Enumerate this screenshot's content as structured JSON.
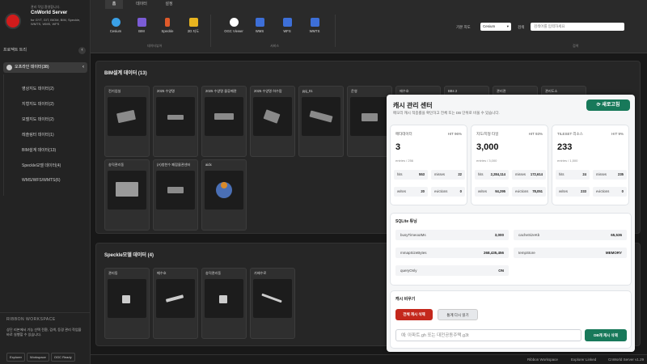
{
  "brand": {
    "subtitle": "관리 작업 환영합니다.",
    "name": "CnWorld Server",
    "desc": "for GYT, GIT, BIOM, BIM, Speckle, WMTS, WMS, WFS"
  },
  "sidebar": {
    "project_tree_label": "프로젝트 트리",
    "root": {
      "label": "오프라인 데이터(38)"
    },
    "items": [
      {
        "label": "영상지도 데이터(2)"
      },
      {
        "label": "지형지도 데이터(2)"
      },
      {
        "label": "모델지도 데이터(2)"
      },
      {
        "label": "레솔링터 데이터(1)"
      },
      {
        "label": "BIM설계 데이터(13)"
      },
      {
        "label": "Speckle모델 데이터(4)"
      },
      {
        "label": "WMS/WFS/WMTS(6)"
      }
    ],
    "ribbon_title": "RIBBON WORKSPACE",
    "ribbon_text": "상단 리본에서 기능 선택 전환, 검색, 등경 관리 작업을 바로 실행할 수 있습니다.",
    "tags": [
      "Explorer",
      "Workspace",
      "OGC Ready"
    ]
  },
  "tabs": [
    "홈",
    "데이터",
    "설정"
  ],
  "toolbar": {
    "tools_group1": [
      {
        "label": "Cesium",
        "icon": "globe-icon"
      },
      {
        "label": "BIM",
        "icon": "building-icon"
      },
      {
        "label": "Speckle",
        "icon": "speckle-icon"
      },
      {
        "label": "2D 지도",
        "icon": "map-icon"
      }
    ],
    "group1_label": "데이터뷰어",
    "tools_group2": [
      {
        "label": "OGC Viewer",
        "icon": "ogc-icon"
      },
      {
        "label": "WMS",
        "icon": "layers-icon"
      },
      {
        "label": "WFS",
        "icon": "layers-icon"
      },
      {
        "label": "WMTS",
        "icon": "layers-icon"
      }
    ],
    "group2_label": "서비스",
    "base_label": "기본 지도",
    "base_value": "Cesium",
    "search_label": "검색",
    "search_placeholder": "검색어를 입력하세요",
    "search_group_label": "검색"
  },
  "bim_section": {
    "title": "BIM설계 데이터 (13)",
    "cards": [
      "전기업실",
      "2025 수양명",
      "2025 수양명 물류폐관",
      "2025 수양명 하수맘",
      "ppj_01",
      "운영",
      "애수호",
      "BBs 2",
      "관리관",
      "관리도소",
      "송덕관리동",
      "(A)청천수 폐잡물관센터",
      "aidx"
    ]
  },
  "speckle_section": {
    "title": "Speckle모델 데이터 (4)",
    "cards": [
      "관리동",
      "메수호",
      "송덕관리동",
      "가배수로"
    ]
  },
  "footer": {
    "a": "Ribbon Workspace",
    "b": "Explorer Linked",
    "c": "CnWorld Server v1.29"
  },
  "cache": {
    "title": "캐시 관리 센터",
    "subtitle": "메모리 캐시 적중률을 확인하고 전체 또는 DB 단위로 비울 수 있습니다.",
    "refresh_label": "새로고침",
    "stats": [
      {
        "name": "메타데이터",
        "hit": "HIT 96%",
        "value": "3",
        "entries": "entries / 256",
        "hits": "553",
        "misses": "22",
        "writes": "20",
        "evictions": "0"
      },
      {
        "name": "지도/지형 타일",
        "hit": "HIT 93%",
        "value": "3,000",
        "entries": "entries / 3,000",
        "hits": "2,284,114",
        "misses": "172,614",
        "writes": "94,295",
        "evictions": "78,051"
      },
      {
        "name": "TILESET 리소스",
        "hit": "HIT 9%",
        "value": "233",
        "entries": "entries / 1,500",
        "hits": "24",
        "misses": "235",
        "writes": "233",
        "evictions": "0"
      }
    ],
    "labels": {
      "hits": "hits",
      "misses": "misses",
      "writes": "writes",
      "evictions": "evictions"
    },
    "sqlite_title": "SQLite 튜닝",
    "sqlite": [
      {
        "k": "busyTimeoutMs",
        "v": "3,000"
      },
      {
        "k": "cacheSizeKb",
        "v": "65,536"
      },
      {
        "k": "mmapSizeBytes",
        "v": "268,435,456"
      },
      {
        "k": "tempStore",
        "v": "MEMORY"
      },
      {
        "k": "queryOnly",
        "v": "ON"
      }
    ],
    "clear_title": "캐시 비우기",
    "clear_all": "전체 캐시 삭제",
    "reread": "통계 다시 읽기",
    "db_placeholder": "예: 아파트.gh 또는 대전공동주택.g3t",
    "db_clear": "DB캐 캐시 삭제"
  },
  "colors": {
    "accent": "#18795a",
    "danger": "#c4281c",
    "brand": "#d21b1b"
  }
}
